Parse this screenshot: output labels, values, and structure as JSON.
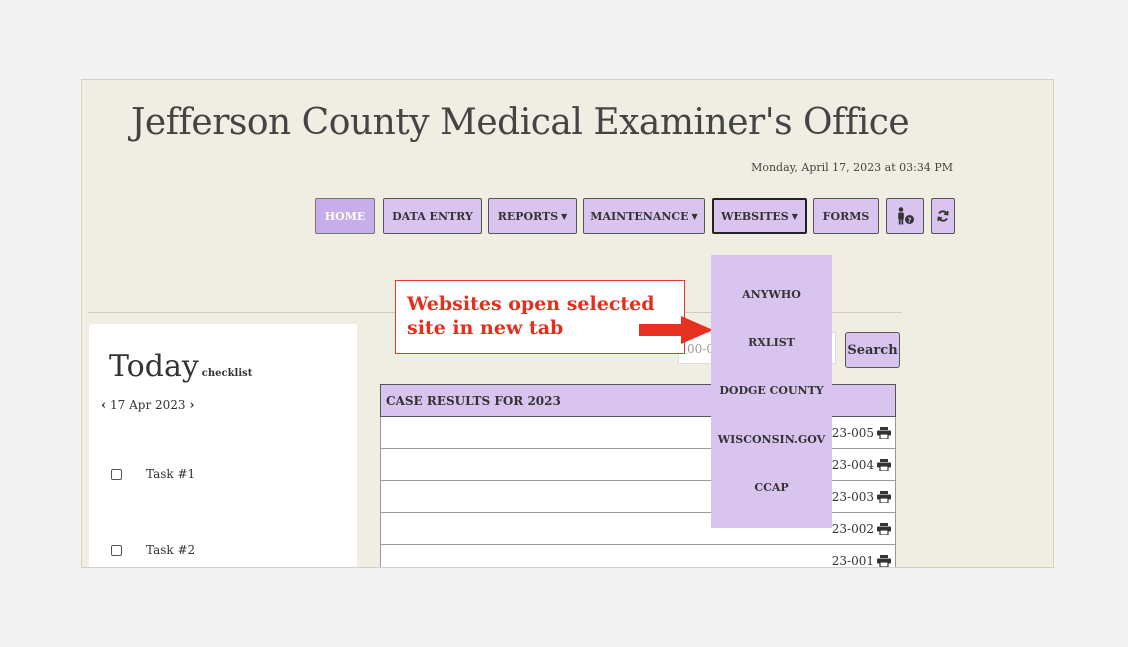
{
  "header": {
    "title": "Jefferson County Medical Examiner's Office",
    "datetime": "Monday, April 17, 2023 at 03:34 PM"
  },
  "nav": {
    "home": "HOME",
    "data_entry": "DATA ENTRY",
    "reports": "REPORTS",
    "maintenance": "MAINTENANCE",
    "websites": "WEBSITES",
    "forms": "FORMS",
    "active": "HOME",
    "open_menu": "WEBSITES"
  },
  "websites_menu": [
    "ANYWHO",
    "RXLIST",
    "DODGE COUNTY",
    "WISCONSIN.GOV",
    "CCAP"
  ],
  "today": {
    "title": "Today",
    "subtitle": "checklist",
    "date": "17 Apr 2023",
    "tasks": [
      "Task #1",
      "Task #2"
    ]
  },
  "search": {
    "value": "00-0",
    "button": "Search"
  },
  "results": {
    "header": "CASE RESULTS FOR 2023",
    "cases": [
      "23-005",
      "23-004",
      "23-003",
      "23-002",
      "23-001"
    ]
  },
  "annotation": {
    "text_line1": "Websites open selected",
    "text_line2": "site in new tab",
    "color": "#e0301e"
  },
  "colors": {
    "accent": "#d9c4ef",
    "page_bg": "#f0eee3"
  }
}
